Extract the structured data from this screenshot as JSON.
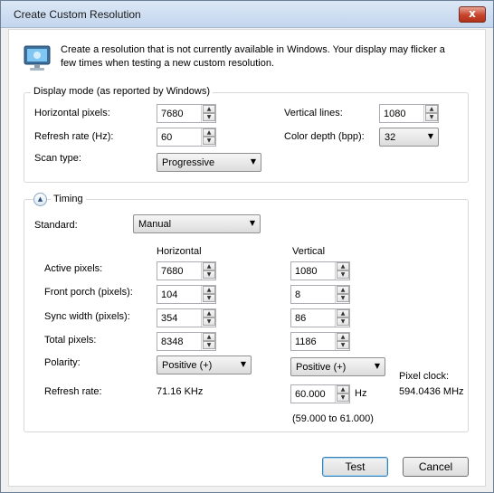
{
  "window": {
    "title": "Create Custom Resolution",
    "close_glyph": "x"
  },
  "intro": {
    "icon": "monitor-icon",
    "text": "Create a resolution that is not currently available in Windows. Your display may flicker a few times when testing a new custom resolution."
  },
  "display_mode": {
    "group_label": "Display mode (as reported by Windows)",
    "horizontal_pixels_label": "Horizontal pixels:",
    "horizontal_pixels_value": "7680",
    "vertical_lines_label": "Vertical lines:",
    "vertical_lines_value": "1080",
    "refresh_rate_label": "Refresh rate (Hz):",
    "refresh_rate_value": "60",
    "color_depth_label": "Color depth (bpp):",
    "color_depth_value": "32",
    "scan_type_label": "Scan type:",
    "scan_type_value": "Progressive"
  },
  "timing": {
    "group_label": "Timing",
    "standard_label": "Standard:",
    "standard_value": "Manual",
    "col_horizontal": "Horizontal",
    "col_vertical": "Vertical",
    "rows": {
      "active_label": "Active pixels:",
      "active_h": "7680",
      "active_v": "1080",
      "front_porch_label": "Front porch (pixels):",
      "front_porch_h": "104",
      "front_porch_v": "8",
      "sync_width_label": "Sync width (pixels):",
      "sync_width_h": "354",
      "sync_width_v": "86",
      "total_label": "Total pixels:",
      "total_h": "8348",
      "total_v": "1186",
      "polarity_label": "Polarity:",
      "polarity_h": "Positive (+)",
      "polarity_v": "Positive (+)",
      "refresh_label": "Refresh rate:",
      "refresh_h": "71.16 KHz",
      "refresh_v": "60.000",
      "refresh_unit": "Hz",
      "refresh_range": "(59.000 to 61.000)"
    },
    "pixel_clock_label": "Pixel clock:",
    "pixel_clock_value": "594.0436 MHz"
  },
  "buttons": {
    "test": "Test",
    "cancel": "Cancel"
  },
  "glyphs": {
    "spin_up": "▲",
    "spin_down": "▼",
    "dropdown": "▼",
    "collapse": "▲"
  }
}
